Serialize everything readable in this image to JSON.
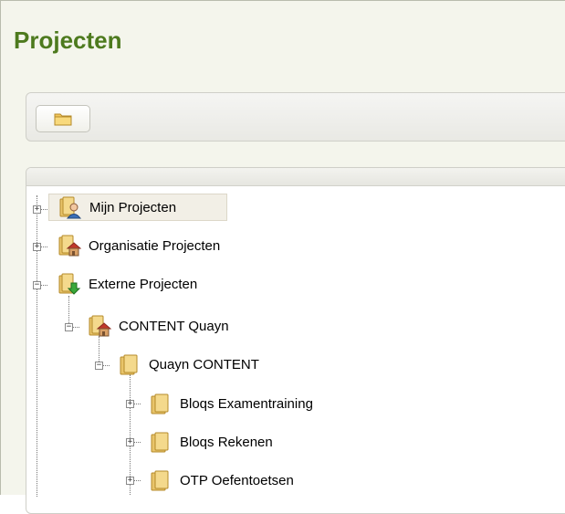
{
  "page": {
    "title": "Projecten"
  },
  "toolbar": {
    "buttons": [
      {
        "icon": "folder-icon"
      }
    ]
  },
  "tree": {
    "nodes": [
      {
        "label": "Mijn Projecten",
        "icon": "user-folder-icon",
        "state": "collapsed",
        "selected": true
      },
      {
        "label": "Organisatie Projecten",
        "icon": "house-folder-icon",
        "state": "collapsed"
      },
      {
        "label": "Externe Projecten",
        "icon": "download-folder-icon",
        "state": "expanded"
      },
      {
        "label": "CONTENT Quayn",
        "icon": "house-folder-icon",
        "state": "expanded"
      },
      {
        "label": "Quayn CONTENT",
        "icon": "folder-icon",
        "state": "expanded"
      },
      {
        "label": "Bloqs Examentraining",
        "icon": "folder-icon",
        "state": "collapsed"
      },
      {
        "label": "Bloqs Rekenen",
        "icon": "folder-icon",
        "state": "collapsed"
      },
      {
        "label": "OTP Oefentoetsen",
        "icon": "folder-icon",
        "state": "collapsed"
      }
    ]
  },
  "colors": {
    "title": "#4d7a1e",
    "background": "#f4f5ec",
    "folder": "#e8c46a"
  }
}
